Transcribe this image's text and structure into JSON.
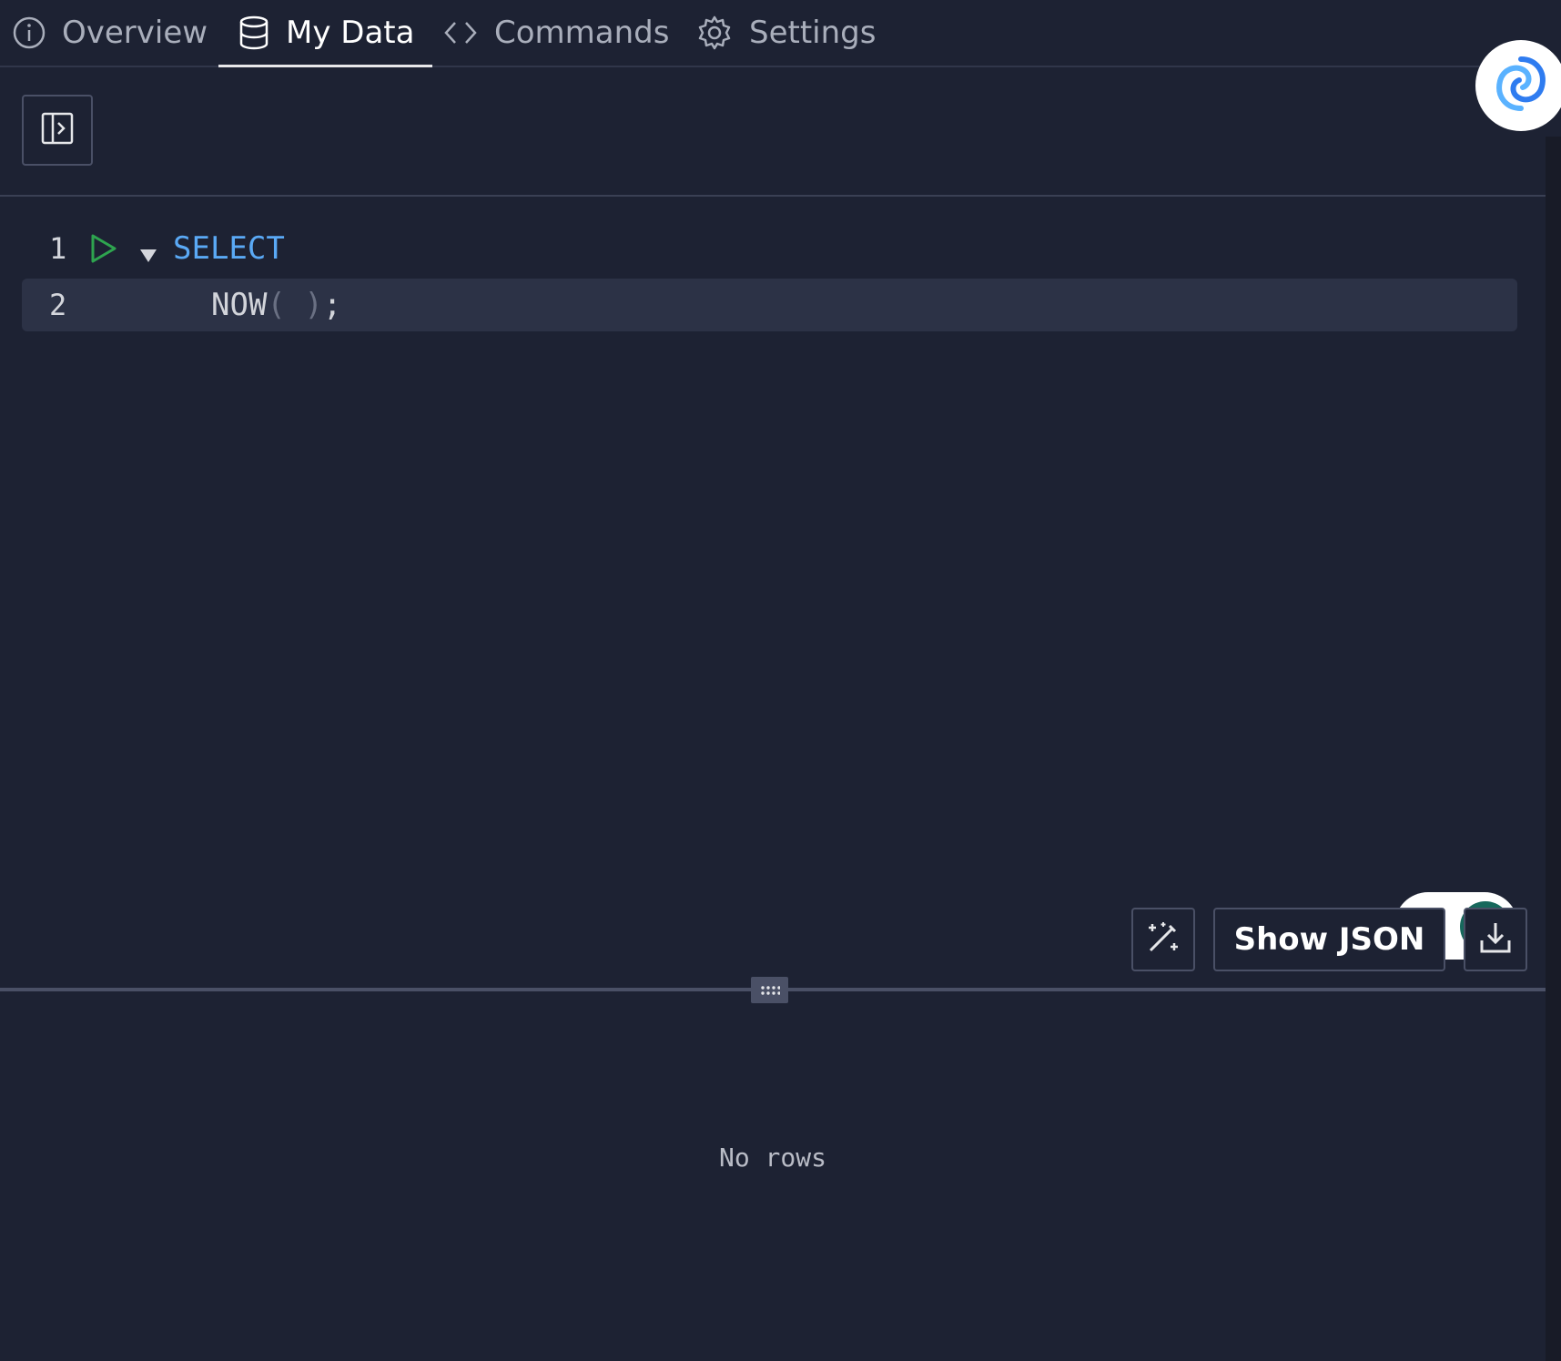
{
  "tabs": [
    {
      "label": "Overview",
      "icon": "info-icon"
    },
    {
      "label": "My Data",
      "icon": "database-icon",
      "active": true
    },
    {
      "label": "Commands",
      "icon": "code-icon"
    },
    {
      "label": "Settings",
      "icon": "gear-icon"
    }
  ],
  "editor": {
    "lines": [
      {
        "number": "1",
        "keyword": "SELECT"
      },
      {
        "number": "2",
        "fn": "NOW",
        "open": "(",
        "close": ")",
        "end": ";"
      }
    ]
  },
  "results": {
    "show_json_label": "Show JSON",
    "empty_text": "No rows"
  },
  "colors": {
    "background": "#1d2233",
    "keyword": "#5aa9f5",
    "run": "#2ea44f",
    "toggle_on": "#17685c"
  }
}
